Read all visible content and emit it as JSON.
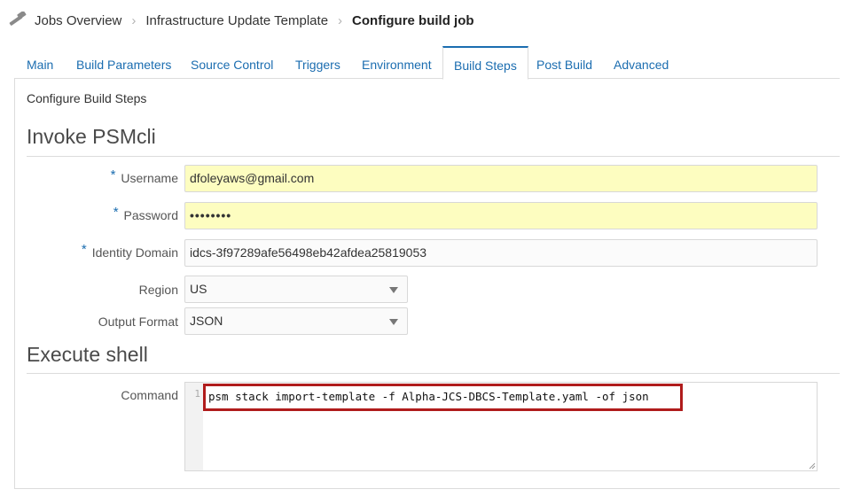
{
  "breadcrumb": {
    "icon": "hammer-icon",
    "items": [
      "Jobs Overview",
      "Infrastructure Update Template",
      "Configure build job"
    ]
  },
  "tabs": [
    {
      "label": "Main"
    },
    {
      "label": "Build Parameters"
    },
    {
      "label": "Source Control"
    },
    {
      "label": "Triggers"
    },
    {
      "label": "Environment"
    },
    {
      "label": "Build Steps",
      "active": true
    },
    {
      "label": "Post Build"
    },
    {
      "label": "Advanced"
    }
  ],
  "panel": {
    "subtitle": "Configure Build Steps",
    "psmcli": {
      "title": "Invoke PSMcli",
      "username": {
        "label": "Username",
        "required": "*",
        "value": "dfoleyaws@gmail.com"
      },
      "password": {
        "label": "Password",
        "required": "*",
        "value": "••••••••"
      },
      "identity_domain": {
        "label": "Identity Domain",
        "required": "*",
        "value": "idcs-3f97289afe56498eb42afdea25819053"
      },
      "region": {
        "label": "Region",
        "value": "US"
      },
      "output_format": {
        "label": "Output Format",
        "value": "JSON"
      }
    },
    "shell": {
      "title": "Execute shell",
      "command_label": "Command",
      "line_number": "1",
      "command": "psm stack import-template -f Alpha-JCS-DBCS-Template.yaml -of json"
    }
  },
  "colors": {
    "link": "#1b6db0",
    "highlight_box": "#b01c1c",
    "autofill": "#fdfdc0"
  }
}
